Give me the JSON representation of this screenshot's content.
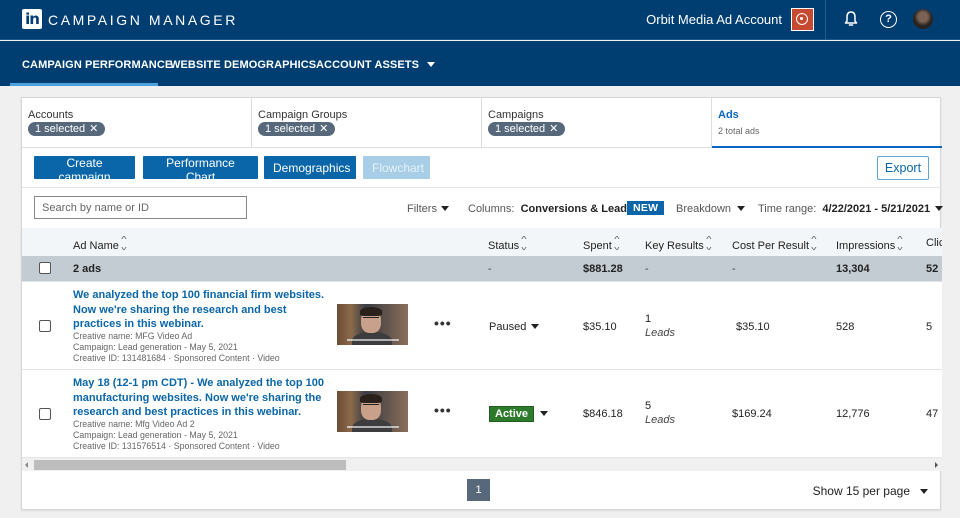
{
  "app": {
    "logo": "in",
    "title": "CAMPAIGN MANAGER",
    "account_name": "Orbit Media Ad Account",
    "icons": {
      "account": "account-target-icon",
      "notifications": "bell-icon",
      "help": "help-icon",
      "profile": "avatar"
    }
  },
  "nav": {
    "tabs": [
      {
        "label": "CAMPAIGN PERFORMANCE",
        "active": true
      },
      {
        "label": "WEBSITE DEMOGRAPHICS",
        "active": false
      },
      {
        "label": "ACCOUNT ASSETS",
        "active": false,
        "has_dropdown": true
      }
    ]
  },
  "breadcrumbs": [
    {
      "label": "Accounts",
      "pill": "1 selected",
      "pill_close": "✕"
    },
    {
      "label": "Campaign Groups",
      "pill": "1 selected",
      "pill_close": "✕"
    },
    {
      "label": "Campaigns",
      "pill": "1 selected",
      "pill_close": "✕"
    },
    {
      "label": "Ads",
      "sub": "2 total ads",
      "active": true
    }
  ],
  "actions": {
    "create_campaign": "Create campaign",
    "performance_chart": "Performance Chart",
    "demographics": "Demographics",
    "flowchart": "Flowchart",
    "export": "Export"
  },
  "toolbar": {
    "search_placeholder": "Search by name or ID",
    "filters": "Filters",
    "columns_label": "Columns:",
    "columns_value": "Conversions & Leads",
    "new_badge": "NEW",
    "breakdown": "Breakdown",
    "time_range_label": "Time range:",
    "time_range_value": "4/22/2021 - 5/21/2021"
  },
  "table": {
    "columns": [
      "Ad Name",
      "Status",
      "Spent",
      "Key Results",
      "Cost Per Result",
      "Impressions",
      "Clic"
    ],
    "summary": {
      "name": "2 ads",
      "status": "-",
      "spent": "$881.28",
      "key_results": "-",
      "cost_per_result": "-",
      "impressions": "13,304",
      "clicks": "52"
    },
    "rows": [
      {
        "title": "We analyzed the top 100 financial firm websites. Now we're sharing the research and best practices in this webinar.",
        "creative_name": "Creative name: MFG Video Ad",
        "campaign": "Campaign: Lead generation - May 5, 2021",
        "creative_id": "Creative ID: 131481684 · Sponsored Content · Video",
        "more": "•••",
        "status": "Paused",
        "spent": "$35.10",
        "key_results": "1",
        "key_results_unit": "Leads",
        "cost_per_result": "$35.10",
        "impressions": "528",
        "clicks": "5"
      },
      {
        "title": "May 18 (12-1 pm CDT) - We analyzed the top 100 manufacturing websites. Now we're sharing the research and best practices in this webinar.",
        "creative_name": "Creative name: Mfg Video Ad 2",
        "campaign": "Campaign: Lead generation - May 5, 2021",
        "creative_id": "Creative ID: 131576514 · Sponsored Content · Video",
        "more": "•••",
        "status": "Active",
        "spent": "$846.18",
        "key_results": "5",
        "key_results_unit": "Leads",
        "cost_per_result": "$169.24",
        "impressions": "12,776",
        "clicks": "47"
      }
    ]
  },
  "pagination": {
    "current_page": "1",
    "per_page": "Show 15 per page"
  },
  "colors": {
    "header_bg": "#003e72",
    "primary": "#0a66a8",
    "active_status": "#2d7a2d",
    "pill_bg": "#56687a",
    "summary_row_bg": "#c3ccd3"
  }
}
